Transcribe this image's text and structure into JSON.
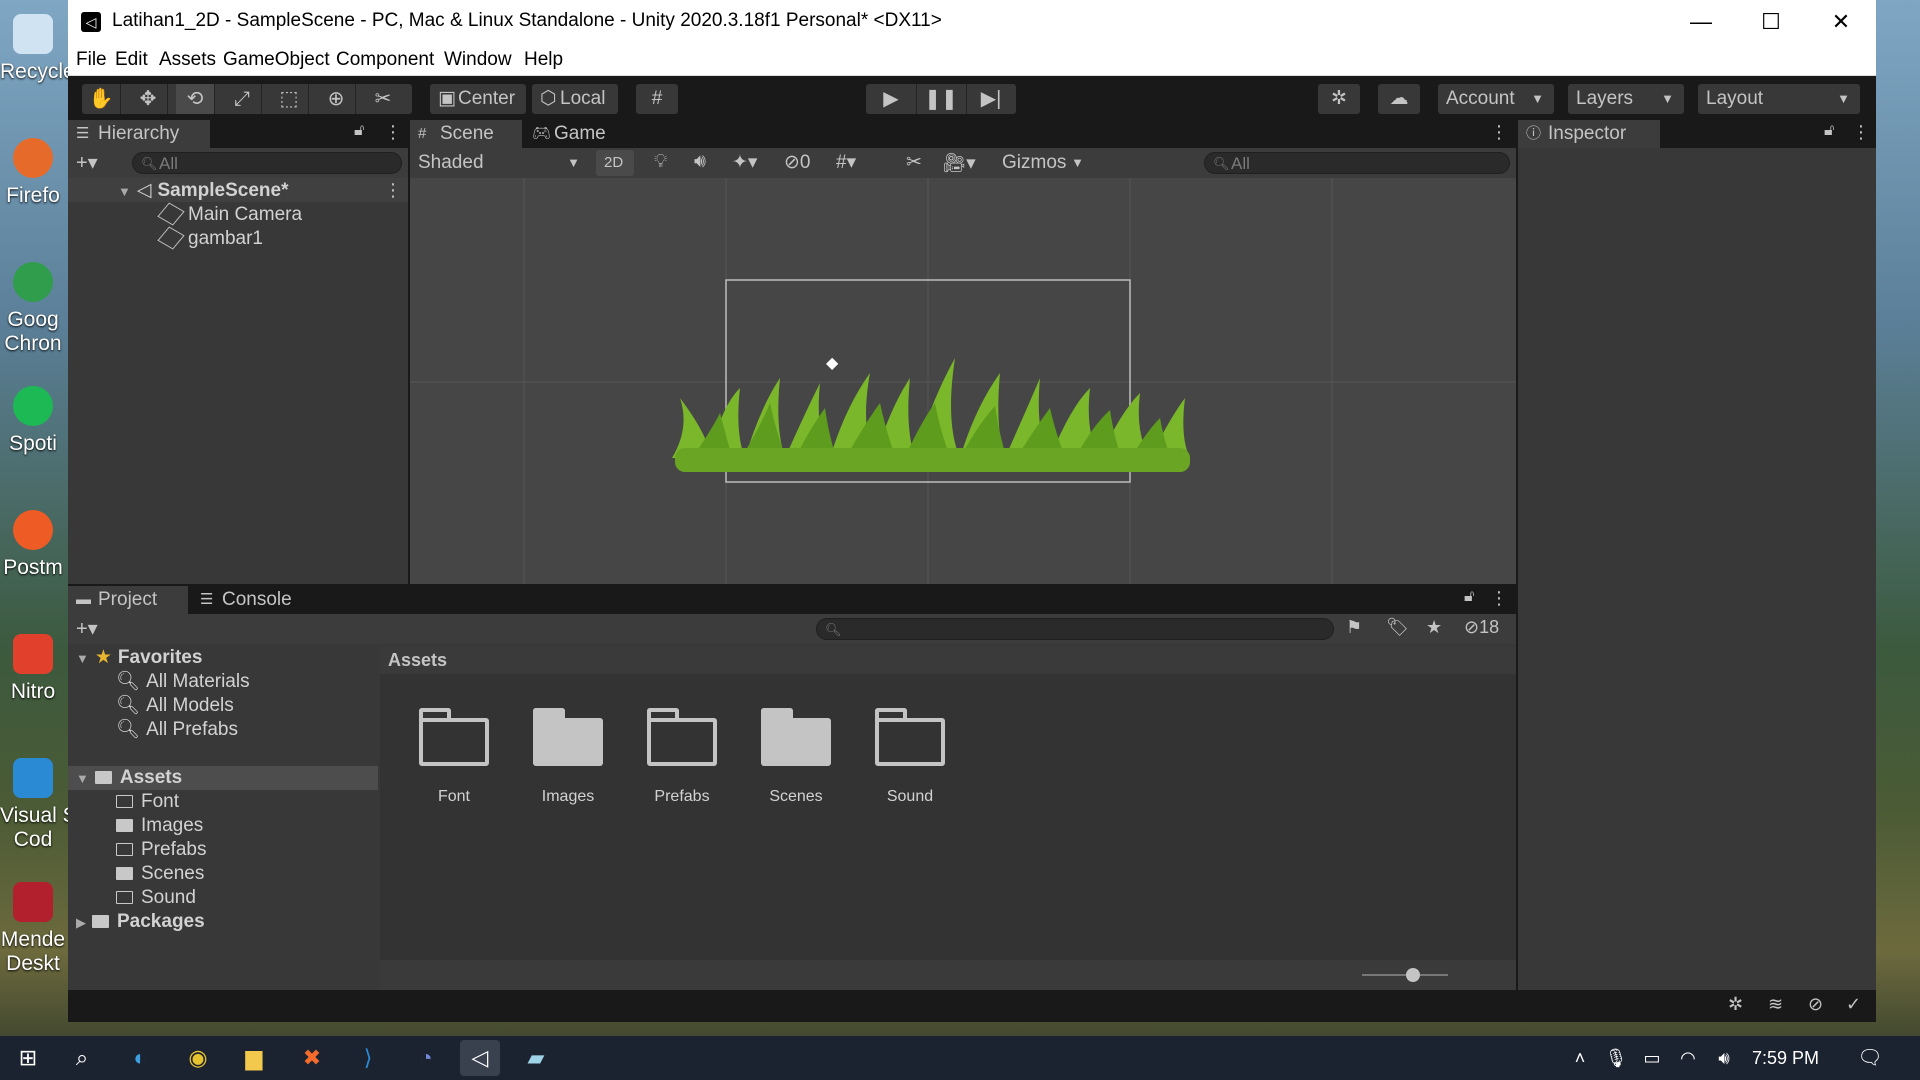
{
  "window": {
    "title": "Latihan1_2D - SampleScene - PC, Mac & Linux Standalone - Unity 2020.3.18f1 Personal* <DX11>",
    "minimize": "—",
    "maximize": "☐",
    "close": "✕"
  },
  "menu": [
    "File",
    "Edit",
    "Assets",
    "GameObject",
    "Component",
    "Window",
    "Help"
  ],
  "toolbar": {
    "pivot": "Center",
    "space": "Local",
    "account": "Account",
    "layers": "Layers",
    "layout": "Layout"
  },
  "hierarchy": {
    "tab": "Hierarchy",
    "search_placeholder": "All",
    "scene": "SampleScene*",
    "items": [
      "Main Camera",
      "gambar1"
    ]
  },
  "scene": {
    "tab_scene": "Scene",
    "tab_game": "Game",
    "shading": "Shaded",
    "mode_2d": "2D",
    "hidden_count": "0",
    "gizmos": "Gizmos",
    "search_placeholder": "All"
  },
  "inspector": {
    "tab": "Inspector"
  },
  "project": {
    "tab_project": "Project",
    "tab_console": "Console",
    "hidden_count": "18",
    "favorites": {
      "label": "Favorites",
      "items": [
        "All Materials",
        "All Models",
        "All Prefabs"
      ]
    },
    "assets_root": "Assets",
    "asset_folders": [
      "Font",
      "Images",
      "Prefabs",
      "Scenes",
      "Sound"
    ],
    "packages": "Packages",
    "breadcrumb": "Assets",
    "grid": [
      {
        "label": "Font",
        "filled": false
      },
      {
        "label": "Images",
        "filled": true
      },
      {
        "label": "Prefabs",
        "filled": false
      },
      {
        "label": "Scenes",
        "filled": true
      },
      {
        "label": "Sound",
        "filled": false
      }
    ]
  },
  "desktop_icons": [
    "Recycle",
    "Firefo",
    "Goog\nChron",
    "Spoti",
    "Postm",
    "Nitro",
    "Visual S\nCod",
    "Mende\nDeskt"
  ],
  "taskbar": {
    "time": "7:59 PM"
  },
  "colors": {
    "accent": "#3a79bb",
    "panel": "#383838",
    "grass": "#7ab72a"
  }
}
